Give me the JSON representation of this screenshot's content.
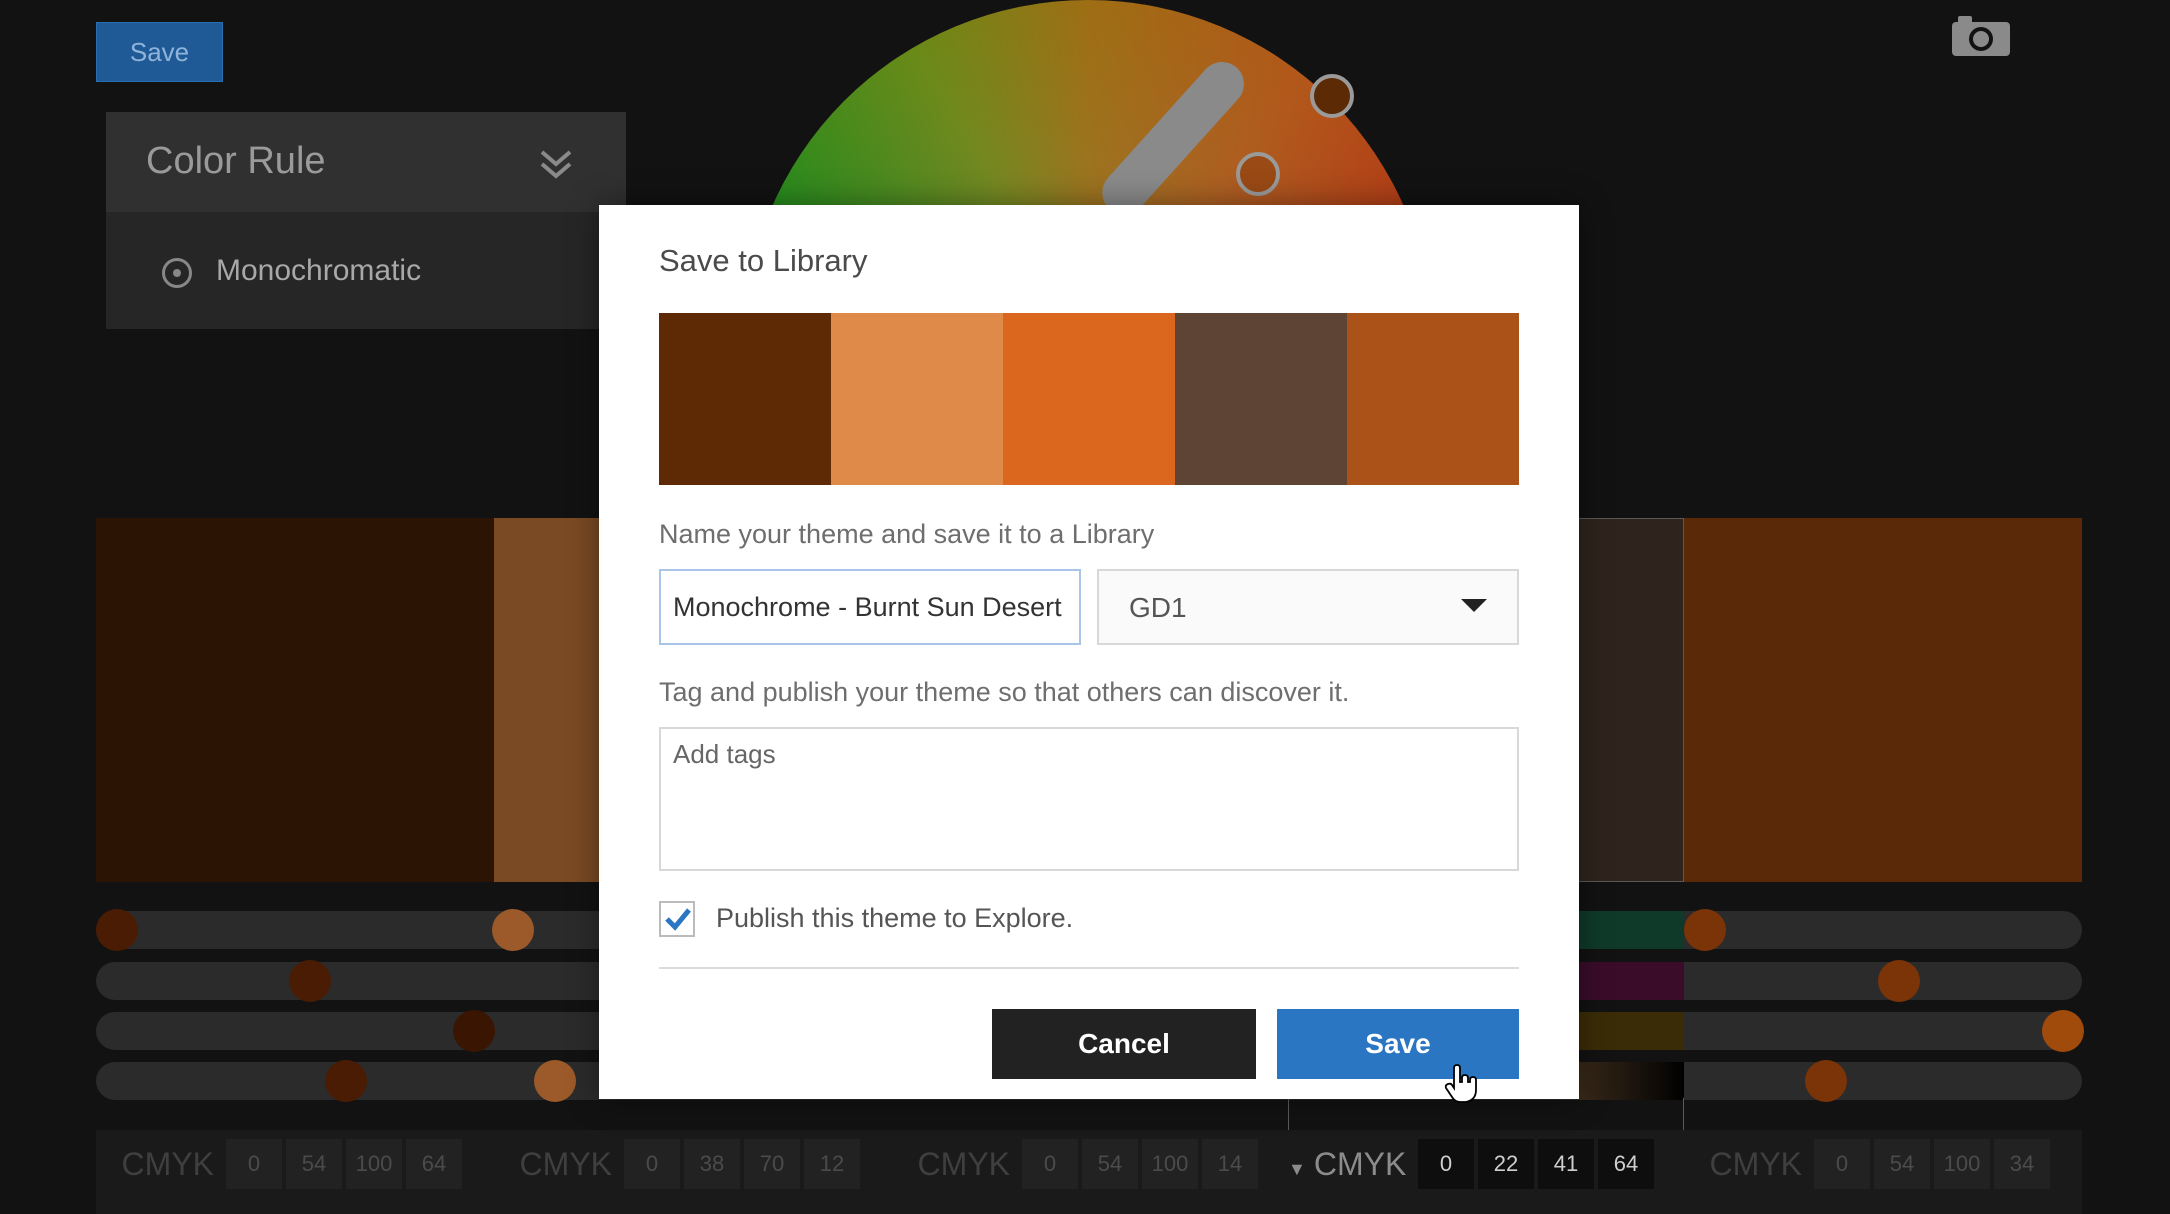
{
  "background": {
    "save_label": "Save",
    "color_rule": {
      "title": "Color Rule",
      "selected_option": "Monochromatic"
    },
    "swatches": [
      "#2c1404",
      "#7a4a24",
      "#1a0e06",
      "#2e241d",
      "#5a2a08"
    ],
    "cmyk_label": "CMYK",
    "cmyk_groups": [
      {
        "values": [
          "0",
          "54",
          "100",
          "64"
        ],
        "active": false
      },
      {
        "values": [
          "0",
          "38",
          "70",
          "12"
        ],
        "active": false
      },
      {
        "values": [
          "0",
          "54",
          "100",
          "14"
        ],
        "active": false
      },
      {
        "values": [
          "0",
          "22",
          "41",
          "64"
        ],
        "active": true
      },
      {
        "values": [
          "0",
          "54",
          "100",
          "34"
        ],
        "active": false
      }
    ]
  },
  "dialog": {
    "title": "Save to Library",
    "palette": [
      "#5e2a06",
      "#e08a4a",
      "#db661e",
      "#5e4434",
      "#ab5218"
    ],
    "name_label": "Name your theme and save it to a Library",
    "theme_name": "Monochrome - Burnt Sun Desert",
    "library": "GD1",
    "tag_label": "Tag and publish your theme so that others can discover it.",
    "tags_placeholder": "Add tags",
    "publish_label": "Publish this theme to Explore.",
    "publish_checked": true,
    "cancel_label": "Cancel",
    "save_label": "Save"
  },
  "icons": [
    "camera-icon",
    "chevron-double-down-icon",
    "radio-icon",
    "dropdown-caret-icon",
    "checkmark-icon",
    "hand-cursor-icon"
  ]
}
